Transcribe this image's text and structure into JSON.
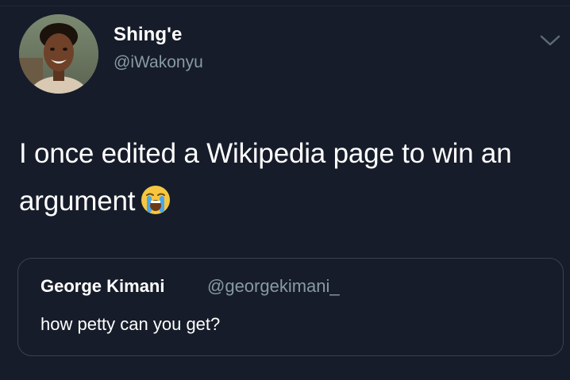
{
  "tweet": {
    "author": {
      "display_name": "Shing'e",
      "handle": "@iWakonyu",
      "avatar_icon": "profile-photo"
    },
    "text": "I once edited a Wikipedia page to win an argument",
    "emoji": "loudly-crying-face-icon",
    "menu_icon": "chevron-down-icon",
    "quoted_tweet": {
      "display_name": "George Kimani",
      "handle": "@georgekimani_",
      "text": "how petty can you get?"
    }
  },
  "colors": {
    "background": "#161c29",
    "primary_text": "#ffffff",
    "secondary_text": "#8899a6",
    "card_border": "#3a4250"
  }
}
